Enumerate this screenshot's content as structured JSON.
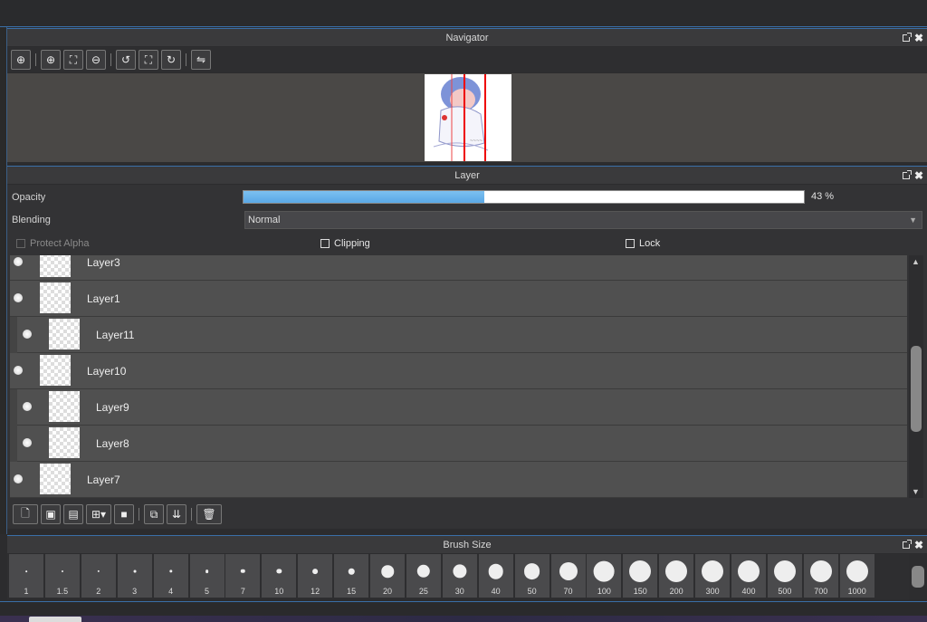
{
  "navigator": {
    "title": "Navigator",
    "toolbar": [
      {
        "icon": "zoom-actual-icon",
        "glyph": "⊕"
      },
      {
        "icon": "zoom-in-icon",
        "glyph": "⊕"
      },
      {
        "icon": "fit-window-icon",
        "glyph": "⛶"
      },
      {
        "icon": "zoom-out-icon",
        "glyph": "⊖"
      },
      {
        "icon": "rotate-left-icon",
        "glyph": "↺"
      },
      {
        "icon": "reset-view-icon",
        "glyph": "⛶"
      },
      {
        "icon": "rotate-right-icon",
        "glyph": "↻"
      },
      {
        "icon": "flip-horizontal-icon",
        "glyph": "⇋"
      }
    ]
  },
  "layer": {
    "title": "Layer",
    "opacity_label": "Opacity",
    "opacity_value": 43,
    "opacity_text": "43 %",
    "blending_label": "Blending",
    "blending_value": "Normal",
    "protect_alpha": "Protect Alpha",
    "clipping": "Clipping",
    "lock": "Lock",
    "layers": [
      {
        "name": "Layer3",
        "clipped": false
      },
      {
        "name": "Layer1",
        "clipped": false
      },
      {
        "name": "Layer11",
        "clipped": true
      },
      {
        "name": "Layer10",
        "clipped": false
      },
      {
        "name": "Layer9",
        "clipped": true
      },
      {
        "name": "Layer8",
        "clipped": true
      },
      {
        "name": "Layer7",
        "clipped": false
      }
    ],
    "toolbar": [
      {
        "icon": "new-layer-icon",
        "glyph": "🗋"
      },
      {
        "icon": "new-halftone-layer-icon",
        "glyph": "▣"
      },
      {
        "icon": "new-1bit-layer-icon",
        "glyph": "▤"
      },
      {
        "icon": "add-layer-menu-icon",
        "glyph": "⊞▾"
      },
      {
        "icon": "new-folder-icon",
        "glyph": "■"
      },
      {
        "icon": "duplicate-layer-icon",
        "glyph": "⧉"
      },
      {
        "icon": "merge-down-icon",
        "glyph": "⇊"
      },
      {
        "icon": "delete-layer-icon",
        "glyph": "🗑"
      }
    ]
  },
  "brush": {
    "title": "Brush Size",
    "sizes": [
      "1",
      "1.5",
      "2",
      "3",
      "4",
      "5",
      "7",
      "10",
      "12",
      "15",
      "20",
      "25",
      "30",
      "40",
      "50",
      "70",
      "100",
      "150",
      "200",
      "300",
      "400",
      "500",
      "700",
      "1000"
    ]
  }
}
